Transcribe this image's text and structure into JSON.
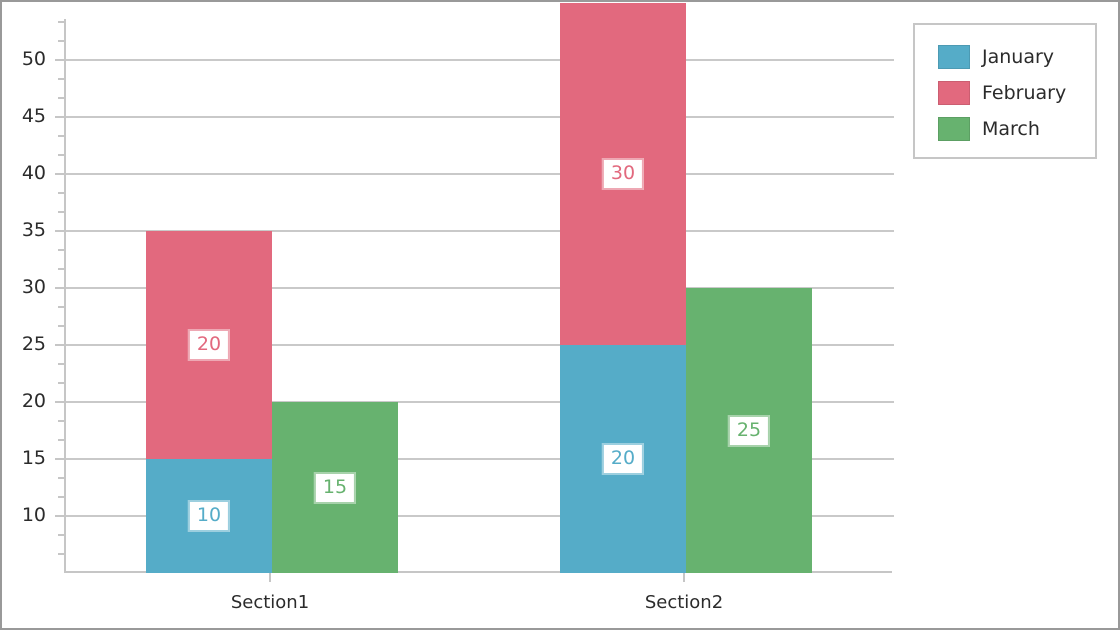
{
  "chart_data": {
    "type": "bar",
    "subtype": "stacked-bar",
    "title": "",
    "subtitle": "",
    "xlabel": "",
    "ylabel": "",
    "categories": [
      "Section1",
      "Section2"
    ],
    "series": [
      {
        "name": "January",
        "color": "#55ACC8",
        "values": [
          10,
          20
        ]
      },
      {
        "name": "February",
        "color": "#E2697E",
        "values": [
          20,
          30
        ]
      },
      {
        "name": "March",
        "color": "#67B26F",
        "values": [
          15,
          25
        ]
      }
    ],
    "stacks": [
      {
        "name": "stack-a",
        "series": [
          "January",
          "February"
        ]
      },
      {
        "name": "stack-b",
        "series": [
          "March"
        ]
      }
    ],
    "stack_totals": {
      "Section1": {
        "stack-a": 30,
        "stack-b": 15
      },
      "Section2": {
        "stack-a": 50,
        "stack-b": 25
      }
    },
    "data_labels": [
      "10",
      "20",
      "15",
      "20",
      "30",
      "25"
    ],
    "ylim": [
      5,
      53.6
    ],
    "ytick_labels": [
      "50",
      "45",
      "40",
      "35",
      "30",
      "25",
      "20",
      "15",
      "10"
    ],
    "ytick_values": [
      50,
      45,
      40,
      35,
      30,
      25,
      20,
      15,
      10
    ],
    "ytick_interval": 5,
    "minor_ticks_between": 2,
    "xtick_labels": [
      "Section1",
      "Section2"
    ],
    "grid": {
      "horizontal": true,
      "vertical": false
    },
    "legend": {
      "position": "top-right",
      "entries": [
        {
          "label": "January",
          "color": "#55ACC8"
        },
        {
          "label": "February",
          "color": "#E2697E"
        },
        {
          "label": "March",
          "color": "#67B26F"
        }
      ]
    },
    "axis_color": "#C6C6C6",
    "grid_color": "#C9C9C9",
    "background": "#FFFFFF",
    "border_color": "#999999"
  }
}
